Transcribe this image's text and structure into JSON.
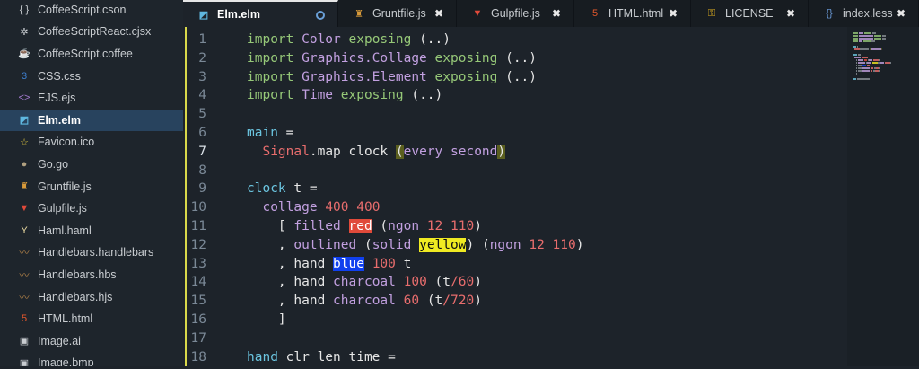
{
  "sidebar": {
    "items": [
      {
        "label": "CoffeeScript.cson",
        "icon": "braces-icon",
        "glyph": "{ }",
        "color": "#c8ccd0"
      },
      {
        "label": "CoffeeScriptReact.cjsx",
        "icon": "atom-icon",
        "glyph": "✲",
        "color": "#c8ccd0"
      },
      {
        "label": "CoffeeScript.coffee",
        "icon": "coffee-icon",
        "glyph": "☕",
        "color": "#c8a060"
      },
      {
        "label": "CSS.css",
        "icon": "css3-icon",
        "glyph": "3",
        "color": "#3d7fd0"
      },
      {
        "label": "EJS.ejs",
        "icon": "code-icon",
        "glyph": "<>",
        "color": "#a47ad0"
      },
      {
        "label": "Elm.elm",
        "icon": "elm-icon",
        "glyph": "◩",
        "color": "#5fb8e0",
        "active": true
      },
      {
        "label": "Favicon.ico",
        "icon": "star-icon",
        "glyph": "☆",
        "color": "#e0c840"
      },
      {
        "label": "Go.go",
        "icon": "gopher-icon",
        "glyph": "●",
        "color": "#b0a080"
      },
      {
        "label": "Gruntfile.js",
        "icon": "grunt-icon",
        "glyph": "♜",
        "color": "#d89a3a"
      },
      {
        "label": "Gulpfile.js",
        "icon": "gulp-icon",
        "glyph": "▼",
        "color": "#e04a3a"
      },
      {
        "label": "Haml.haml",
        "icon": "haml-icon",
        "glyph": "Y",
        "color": "#e8d8a0"
      },
      {
        "label": "Handlebars.handlebars",
        "icon": "mustache-icon",
        "glyph": "〰",
        "color": "#b8864a"
      },
      {
        "label": "Handlebars.hbs",
        "icon": "mustache-icon",
        "glyph": "〰",
        "color": "#b8864a"
      },
      {
        "label": "Handlebars.hjs",
        "icon": "mustache-icon",
        "glyph": "〰",
        "color": "#b8864a"
      },
      {
        "label": "HTML.html",
        "icon": "html5-icon",
        "glyph": "5",
        "color": "#e5582c"
      },
      {
        "label": "Image.ai",
        "icon": "image-icon",
        "glyph": "▣",
        "color": "#c8ccd0"
      },
      {
        "label": "Image.bmp",
        "icon": "image-icon",
        "glyph": "▣",
        "color": "#c8ccd0"
      }
    ]
  },
  "tabs": [
    {
      "label": "Elm.elm",
      "icon": "elm-icon",
      "glyph": "◩",
      "color": "#5fb8e0",
      "active": true,
      "modified": true
    },
    {
      "label": "Gruntfile.js",
      "icon": "grunt-icon",
      "glyph": "♜",
      "color": "#d89a3a",
      "close": "✖"
    },
    {
      "label": "Gulpfile.js",
      "icon": "gulp-icon",
      "glyph": "▼",
      "color": "#e04a3a",
      "close": "✖"
    },
    {
      "label": "HTML.html",
      "icon": "html5-icon",
      "glyph": "5",
      "color": "#e5582c",
      "close": "✖"
    },
    {
      "label": "LICENSE",
      "icon": "key-icon",
      "glyph": "⚿",
      "color": "#e0b020",
      "close": "✖"
    },
    {
      "label": "index.less",
      "icon": "braces-icon",
      "glyph": "{}",
      "color": "#6a9ad8",
      "close": "✖"
    }
  ],
  "editor": {
    "current_line": 7,
    "lines": [
      {
        "n": "1",
        "tokens": [
          [
            "kw",
            "import "
          ],
          [
            "mt",
            "Color "
          ],
          [
            "kw",
            "exposing "
          ],
          [
            "",
            "(..)"
          ]
        ]
      },
      {
        "n": "2",
        "tokens": [
          [
            "kw",
            "import "
          ],
          [
            "mt",
            "Graphics.Collage "
          ],
          [
            "kw",
            "exposing "
          ],
          [
            "",
            "(..)"
          ]
        ]
      },
      {
        "n": "3",
        "tokens": [
          [
            "kw",
            "import "
          ],
          [
            "mt",
            "Graphics.Element "
          ],
          [
            "kw",
            "exposing "
          ],
          [
            "",
            "(..)"
          ]
        ]
      },
      {
        "n": "4",
        "tokens": [
          [
            "kw",
            "import "
          ],
          [
            "mt",
            "Time "
          ],
          [
            "kw",
            "exposing "
          ],
          [
            "",
            "(..)"
          ]
        ]
      },
      {
        "n": "5",
        "tokens": []
      },
      {
        "n": "6",
        "tokens": [
          [
            "fn",
            "main "
          ],
          [
            "",
            "="
          ]
        ]
      },
      {
        "n": "7",
        "tokens": [
          [
            "",
            "  "
          ],
          [
            "ty",
            "Signal"
          ],
          [
            "",
            ".map clock "
          ],
          [
            "hl-br",
            "("
          ],
          [
            "mt",
            "every second"
          ],
          [
            "hl-br",
            ")"
          ]
        ]
      },
      {
        "n": "8",
        "tokens": []
      },
      {
        "n": "9",
        "tokens": [
          [
            "fn",
            "clock "
          ],
          [
            "",
            "t ="
          ]
        ]
      },
      {
        "n": "10",
        "tokens": [
          [
            "",
            "  "
          ],
          [
            "mt",
            "collage "
          ],
          [
            "num",
            "400 400"
          ]
        ]
      },
      {
        "n": "11",
        "tokens": [
          [
            "",
            "    [ "
          ],
          [
            "mt",
            "filled "
          ],
          [
            "hl-red",
            "red"
          ],
          [
            "",
            " ("
          ],
          [
            "mt",
            "ngon "
          ],
          [
            "num",
            "12 110"
          ],
          [
            "",
            ")"
          ]
        ]
      },
      {
        "n": "12",
        "tokens": [
          [
            "",
            "    , "
          ],
          [
            "mt",
            "outlined "
          ],
          [
            "",
            "("
          ],
          [
            "mt",
            "solid "
          ],
          [
            "hl-yellow",
            "yellow"
          ],
          [
            "",
            ") ("
          ],
          [
            "mt",
            "ngon "
          ],
          [
            "num",
            "12 110"
          ],
          [
            "",
            ")"
          ]
        ]
      },
      {
        "n": "13",
        "tokens": [
          [
            "",
            "    , "
          ],
          [
            "",
            "hand "
          ],
          [
            "hl-blue",
            "blue"
          ],
          [
            "",
            " "
          ],
          [
            "num",
            "100"
          ],
          [
            "",
            " t"
          ]
        ]
      },
      {
        "n": "14",
        "tokens": [
          [
            "",
            "    , "
          ],
          [
            "",
            "hand "
          ],
          [
            "mt",
            "charcoal "
          ],
          [
            "num",
            "100"
          ],
          [
            "",
            " (t"
          ],
          [
            "op",
            "/"
          ],
          [
            "num",
            "60"
          ],
          [
            "",
            ")"
          ]
        ]
      },
      {
        "n": "15",
        "tokens": [
          [
            "",
            "    , "
          ],
          [
            "",
            "hand "
          ],
          [
            "mt",
            "charcoal "
          ],
          [
            "num",
            "60"
          ],
          [
            "",
            " (t"
          ],
          [
            "op",
            "/"
          ],
          [
            "num",
            "720"
          ],
          [
            "",
            ")"
          ]
        ]
      },
      {
        "n": "16",
        "tokens": [
          [
            "",
            "    ]"
          ]
        ]
      },
      {
        "n": "17",
        "tokens": []
      },
      {
        "n": "18",
        "tokens": [
          [
            "fn",
            "hand "
          ],
          [
            "",
            "clr len time ="
          ]
        ]
      }
    ]
  }
}
